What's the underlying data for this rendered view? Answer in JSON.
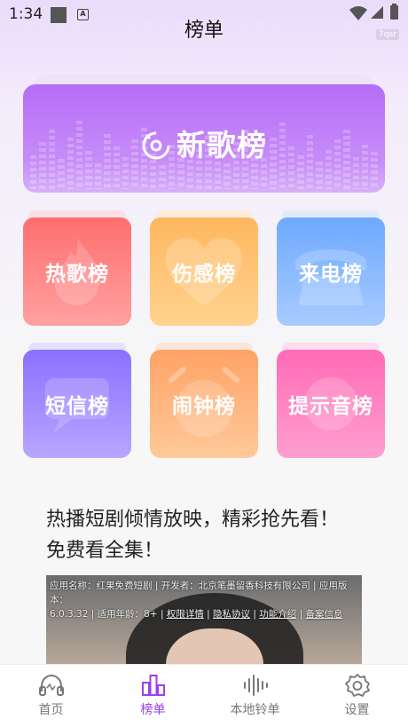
{
  "status_bar": {
    "time": "1:34",
    "badge": "7qsr"
  },
  "page_title": "榜单",
  "banner": {
    "label": "新歌榜"
  },
  "cards": [
    {
      "label": "热歌榜"
    },
    {
      "label": "伤感榜"
    },
    {
      "label": "来电榜"
    },
    {
      "label": "短信榜"
    },
    {
      "label": "闹钟榜"
    },
    {
      "label": "提示音榜"
    }
  ],
  "ad": {
    "headline_line1": "热播短剧倾情放映，精彩抢先看！",
    "headline_line2": "免费看全集！",
    "app_name_label": "应用名称：",
    "app_name": "红果免费短剧",
    "developer": " | 开发者：北京笔墨留香科技有限公司 | 应用版本：",
    "version": "6.0.3.32 | 适用年龄：8+ | ",
    "link_permissions": "权限详情",
    "sep1": " | ",
    "link_privacy": "隐私协议",
    "sep2": " | ",
    "link_features": "功能介绍",
    "sep3": " | ",
    "link_filing": "备案信息"
  },
  "tabbar": {
    "items": [
      {
        "label": "首页"
      },
      {
        "label": "榜单"
      },
      {
        "label": "本地铃单"
      },
      {
        "label": "设置"
      }
    ],
    "active_color": "#9b3ff2"
  }
}
